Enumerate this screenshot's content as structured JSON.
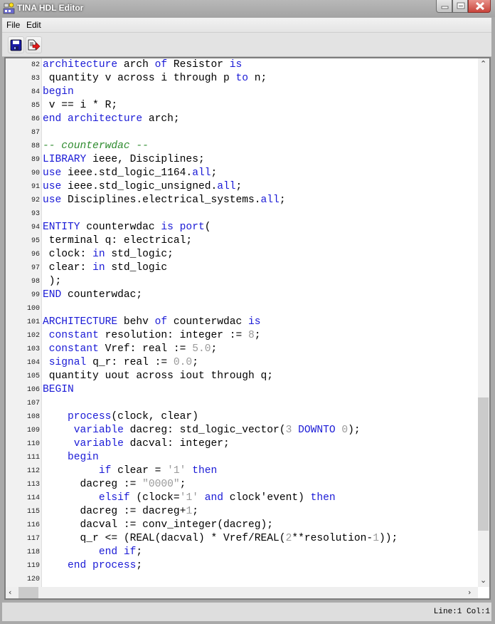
{
  "window": {
    "title": "TINA HDL Editor",
    "controls": {
      "minimize": "minimize",
      "maximize": "maximize",
      "close": "close"
    }
  },
  "menu": {
    "items": [
      "File",
      "Edit"
    ]
  },
  "toolbar": {
    "buttons": [
      {
        "name": "save",
        "icon": "floppy-disk-icon"
      },
      {
        "name": "export",
        "icon": "export-arrow-icon"
      }
    ]
  },
  "editor": {
    "lines": [
      {
        "n": "82",
        "tokens": [
          [
            "kw",
            "architecture"
          ],
          [
            "t",
            " arch "
          ],
          [
            "kw",
            "of"
          ],
          [
            "t",
            " Resistor "
          ],
          [
            "kw",
            "is"
          ]
        ]
      },
      {
        "n": "83",
        "tokens": [
          [
            "t",
            " quantity v across i through p "
          ],
          [
            "kw",
            "to"
          ],
          [
            "t",
            " n;"
          ]
        ]
      },
      {
        "n": "84",
        "tokens": [
          [
            "kw",
            "begin"
          ]
        ]
      },
      {
        "n": "85",
        "tokens": [
          [
            "t",
            " v == i * R;"
          ]
        ]
      },
      {
        "n": "86",
        "tokens": [
          [
            "kw",
            "end architecture"
          ],
          [
            "t",
            " arch;"
          ]
        ]
      },
      {
        "n": "87",
        "tokens": []
      },
      {
        "n": "88",
        "tokens": [
          [
            "cm",
            "-- counterwdac --"
          ]
        ]
      },
      {
        "n": "89",
        "tokens": [
          [
            "kw",
            "LIBRARY"
          ],
          [
            "t",
            " ieee, Disciplines;"
          ]
        ]
      },
      {
        "n": "90",
        "tokens": [
          [
            "kw",
            "use"
          ],
          [
            "t",
            " ieee.std_logic_1164."
          ],
          [
            "kw",
            "all"
          ],
          [
            "t",
            ";"
          ]
        ]
      },
      {
        "n": "91",
        "tokens": [
          [
            "kw",
            "use"
          ],
          [
            "t",
            " ieee.std_logic_unsigned."
          ],
          [
            "kw",
            "all"
          ],
          [
            "t",
            ";"
          ]
        ]
      },
      {
        "n": "92",
        "tokens": [
          [
            "kw",
            "use"
          ],
          [
            "t",
            " Disciplines.electrical_systems."
          ],
          [
            "kw",
            "all"
          ],
          [
            "t",
            ";"
          ]
        ]
      },
      {
        "n": "93",
        "tokens": []
      },
      {
        "n": "94",
        "tokens": [
          [
            "kw",
            "ENTITY"
          ],
          [
            "t",
            " counterwdac "
          ],
          [
            "kw",
            "is port"
          ],
          [
            "t",
            "("
          ]
        ]
      },
      {
        "n": "95",
        "tokens": [
          [
            "t",
            " terminal q: electrical;"
          ]
        ]
      },
      {
        "n": "96",
        "tokens": [
          [
            "t",
            " clock: "
          ],
          [
            "kw",
            "in"
          ],
          [
            "t",
            " std_logic;"
          ]
        ]
      },
      {
        "n": "97",
        "tokens": [
          [
            "t",
            " clear: "
          ],
          [
            "kw",
            "in"
          ],
          [
            "t",
            " std_logic"
          ]
        ]
      },
      {
        "n": "98",
        "tokens": [
          [
            "t",
            " );"
          ]
        ]
      },
      {
        "n": "99",
        "tokens": [
          [
            "kw",
            "END"
          ],
          [
            "t",
            " counterwdac;"
          ]
        ]
      },
      {
        "n": "100",
        "tokens": []
      },
      {
        "n": "101",
        "tokens": [
          [
            "kw",
            "ARCHITECTURE"
          ],
          [
            "t",
            " behv "
          ],
          [
            "kw",
            "of"
          ],
          [
            "t",
            " counterwdac "
          ],
          [
            "kw",
            "is"
          ]
        ]
      },
      {
        "n": "102",
        "tokens": [
          [
            "t",
            " "
          ],
          [
            "kw",
            "constant"
          ],
          [
            "t",
            " resolution: integer := "
          ],
          [
            "num",
            "8"
          ],
          [
            "t",
            ";"
          ]
        ]
      },
      {
        "n": "103",
        "tokens": [
          [
            "t",
            " "
          ],
          [
            "kw",
            "constant"
          ],
          [
            "t",
            " Vref: real := "
          ],
          [
            "num",
            "5.0"
          ],
          [
            "t",
            ";"
          ]
        ]
      },
      {
        "n": "104",
        "tokens": [
          [
            "t",
            " "
          ],
          [
            "kw",
            "signal"
          ],
          [
            "t",
            " q_r: real := "
          ],
          [
            "num",
            "0.0"
          ],
          [
            "t",
            ";"
          ]
        ]
      },
      {
        "n": "105",
        "tokens": [
          [
            "t",
            " quantity uout across iout through q;"
          ]
        ]
      },
      {
        "n": "106",
        "tokens": [
          [
            "kw",
            "BEGIN"
          ]
        ]
      },
      {
        "n": "107",
        "tokens": []
      },
      {
        "n": "108",
        "tokens": [
          [
            "t",
            "    "
          ],
          [
            "kw",
            "process"
          ],
          [
            "t",
            "(clock, clear)"
          ]
        ]
      },
      {
        "n": "109",
        "tokens": [
          [
            "t",
            "     "
          ],
          [
            "kw",
            "variable"
          ],
          [
            "t",
            " dacreg: std_logic_vector("
          ],
          [
            "num",
            "3"
          ],
          [
            "t",
            " "
          ],
          [
            "kw",
            "DOWNTO"
          ],
          [
            "t",
            " "
          ],
          [
            "num",
            "0"
          ],
          [
            "t",
            ");"
          ]
        ]
      },
      {
        "n": "110",
        "tokens": [
          [
            "t",
            "     "
          ],
          [
            "kw",
            "variable"
          ],
          [
            "t",
            " dacval: integer;"
          ]
        ]
      },
      {
        "n": "111",
        "tokens": [
          [
            "t",
            "    "
          ],
          [
            "kw",
            "begin"
          ]
        ]
      },
      {
        "n": "112",
        "tokens": [
          [
            "t",
            "         "
          ],
          [
            "kw",
            "if"
          ],
          [
            "t",
            " clear = "
          ],
          [
            "str",
            "'1'"
          ],
          [
            "t",
            " "
          ],
          [
            "kw",
            "then"
          ]
        ]
      },
      {
        "n": "113",
        "tokens": [
          [
            "t",
            "      dacreg := "
          ],
          [
            "str",
            "\"0000\""
          ],
          [
            "t",
            ";"
          ]
        ]
      },
      {
        "n": "114",
        "tokens": [
          [
            "t",
            "         "
          ],
          [
            "kw",
            "elsif"
          ],
          [
            "t",
            " (clock="
          ],
          [
            "str",
            "'1'"
          ],
          [
            "t",
            " "
          ],
          [
            "kw",
            "and"
          ],
          [
            "t",
            " clock'event) "
          ],
          [
            "kw",
            "then"
          ]
        ]
      },
      {
        "n": "115",
        "tokens": [
          [
            "t",
            "      dacreg := dacreg+"
          ],
          [
            "num",
            "1"
          ],
          [
            "t",
            ";"
          ]
        ]
      },
      {
        "n": "116",
        "tokens": [
          [
            "t",
            "      dacval := conv_integer(dacreg);"
          ]
        ]
      },
      {
        "n": "117",
        "tokens": [
          [
            "t",
            "      q_r <= (REAL(dacval) * Vref/REAL("
          ],
          [
            "num",
            "2"
          ],
          [
            "t",
            "**resolution-"
          ],
          [
            "num",
            "1"
          ],
          [
            "t",
            "));"
          ]
        ]
      },
      {
        "n": "118",
        "tokens": [
          [
            "t",
            "         "
          ],
          [
            "kw",
            "end if"
          ],
          [
            "t",
            ";"
          ]
        ]
      },
      {
        "n": "119",
        "tokens": [
          [
            "t",
            "    "
          ],
          [
            "kw",
            "end process"
          ],
          [
            "t",
            ";"
          ]
        ]
      },
      {
        "n": "120",
        "tokens": []
      }
    ],
    "vertical_scroll_fraction": 0.88,
    "horizontal_scroll_fraction": 0.0
  },
  "status": {
    "position": "Line:1 Col:1"
  },
  "colors": {
    "keyword": "#1a1ad6",
    "number": "#9a9a9a",
    "comment": "#2e8b2e",
    "close_button": "#d9534f"
  }
}
